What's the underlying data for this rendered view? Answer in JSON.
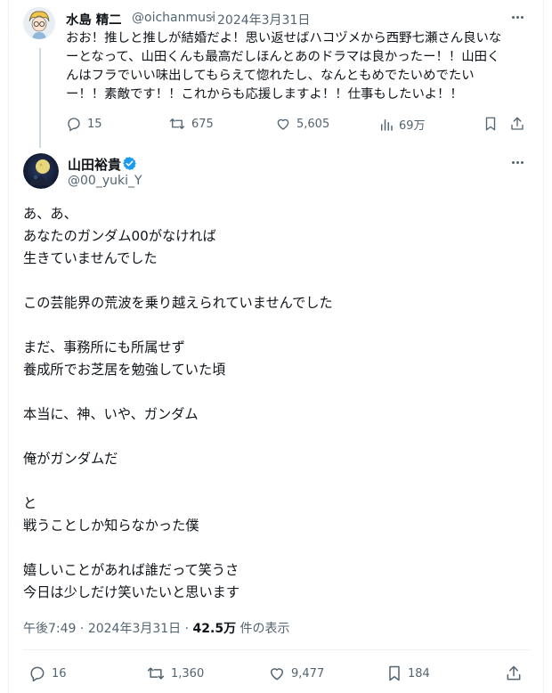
{
  "reply_post": {
    "author_name": "水島 精二",
    "handle": "@oichanmusi",
    "separator": "·",
    "date": "2024年3月31日",
    "text_lines": [
      "おお！推しと推しが結婚だよ！思い返せばハコヅメから西野七瀬さん良いな",
      "ーとなって、山田くんも最高だしほんとあのドラマは良かったー！！山田く",
      "んはフラでいい味出してもらえて惚れたし、なんともめでたいめでたい",
      "ー！！素敵です！！これからも応援しますよ！！仕事もしたいよ！！"
    ],
    "actions": {
      "replies": "15",
      "reposts": "675",
      "likes": "5,605",
      "views": "69万"
    },
    "icons": [
      "reply-icon",
      "repost-icon",
      "like-icon",
      "views-icon",
      "bookmark-icon",
      "share-icon",
      "more-icon"
    ]
  },
  "main_post": {
    "author_name": "山田裕貴",
    "verified": true,
    "handle": "@00_yuki_Y",
    "text_lines": [
      "あ、あ、",
      "あなたのガンダム00がなければ",
      "生きていませんでした",
      "",
      "この芸能界の荒波を乗り越えられていませんでした",
      "",
      "まだ、事務所にも所属せず",
      "養成所でお芝居を勉強していた頃",
      "",
      "本当に、神、いや、ガンダム",
      "",
      "俺がガンダムだ",
      "",
      "と",
      "戦うことしか知らなかった僕",
      "",
      "嬉しいことがあれば誰だって笑うさ",
      "今日は少しだけ笑いたいと思います"
    ],
    "meta": {
      "time": "午後7:49",
      "separator": "·",
      "date": "2024年3月31日",
      "separator2": "·",
      "views_count": "42.5万",
      "views_label": "件の表示"
    },
    "actions": {
      "replies": "16",
      "reposts": "1,360",
      "likes": "9,477",
      "bookmarks": "184"
    },
    "colors": {
      "verified_badge": "#1d9bf0",
      "muted_text": "#536471",
      "divider": "#eff3f4"
    }
  }
}
